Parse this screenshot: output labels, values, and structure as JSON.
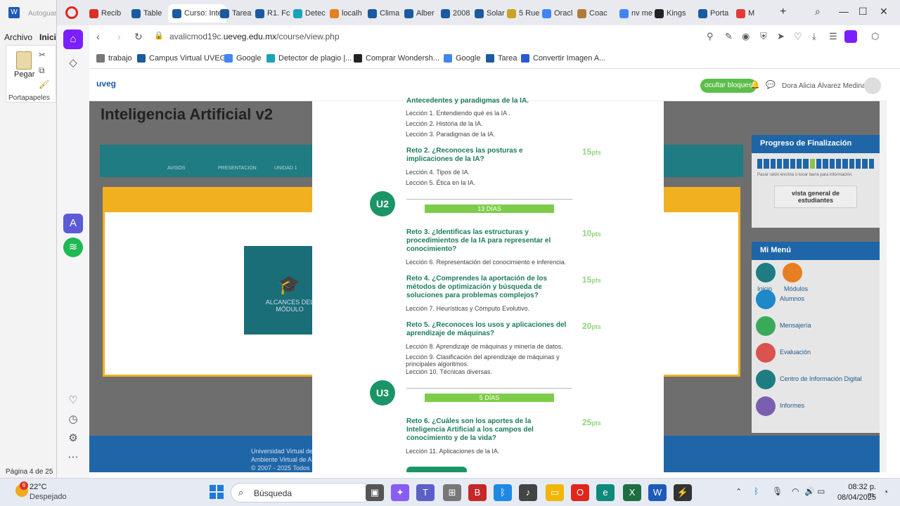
{
  "word": {
    "autosave": "Autoguar",
    "menu_archivo": "Archivo",
    "menu_inicio": "Inicio",
    "paste_label": "Pegar",
    "clipboard_group": "Portapapeles",
    "status": "Página 4 de 25"
  },
  "browser": {
    "tabs": [
      {
        "label": "Recib",
        "color": "#d93025"
      },
      {
        "label": "Table",
        "color": "#1a5aa0"
      },
      {
        "label": "Curso: Inte",
        "color": "#1a5aa0",
        "active": true
      },
      {
        "label": "Tarea",
        "color": "#1a5aa0"
      },
      {
        "label": "R1. Fc",
        "color": "#1a5aa0"
      },
      {
        "label": "Detec",
        "color": "#19a3b8"
      },
      {
        "label": "localh",
        "color": "#e67e22"
      },
      {
        "label": "Clima",
        "color": "#1a5aa0"
      },
      {
        "label": "Alber",
        "color": "#1a5aa0"
      },
      {
        "label": "2008",
        "color": "#1a5aa0"
      },
      {
        "label": "Solar",
        "color": "#1a5aa0"
      },
      {
        "label": "5 Rue",
        "color": "#c9a227"
      },
      {
        "label": "Oracl",
        "color": "#4285f4"
      },
      {
        "label": "Coac",
        "color": "#b07a3a"
      },
      {
        "label": "nv me",
        "color": "#4285f4"
      },
      {
        "label": "Kings",
        "color": "#222"
      },
      {
        "label": "Porta",
        "color": "#1a5aa0"
      },
      {
        "label": "M",
        "color": "#e53935"
      }
    ],
    "url_prefix": "avalicmod19c.",
    "url_domain": "ueveg.edu.mx",
    "url_path": "/course/view.php",
    "bookmarks": [
      {
        "label": "trabajo",
        "color": "#777"
      },
      {
        "label": "Campus Virtual UVEG",
        "color": "#1a5aa0"
      },
      {
        "label": "Google",
        "color": "#4285f4"
      },
      {
        "label": "Detector de plagio |...",
        "color": "#19a3b8"
      },
      {
        "label": "Comprar Wondersh...",
        "color": "#222"
      },
      {
        "label": "Google",
        "color": "#4285f4"
      },
      {
        "label": "Tarea",
        "color": "#1a5aa0"
      },
      {
        "label": "Convertir Imagen A...",
        "color": "#2a5bd7"
      }
    ]
  },
  "site": {
    "logo": "uveg",
    "hide_blocks": "ocultar bloques",
    "user_name": "Dora Alicia Álvarez Medina",
    "course_title": "Inteligencia Artificial v2",
    "teal_items": [
      "AVISOS",
      "PRESENTACIÓN",
      "UNIDAD 1"
    ],
    "module_label": "ALCANCES DEL MÓDULO",
    "progress_title": "Progreso de Finalización",
    "progress_hint": "Pasar ratón encima o tocar barra para información.",
    "students_button": "vista general de estudiantes",
    "menu_title": "Mi Menú",
    "menu_items": [
      "Inicio",
      "Módulos",
      "Alumnos",
      "Mensajería",
      "Evaluación",
      "Centro de Información Digital",
      "Informes"
    ],
    "footer_line1": "Universidad Virtual de",
    "footer_line2": "Ambiente Virtual de A",
    "footer_line3": "© 2007 - 2025 Todos"
  },
  "modal": {
    "partial_heading": "Antecedentes y paradigmas de la IA.",
    "u1_lessons": [
      "Lección 1. Entendiendo qué es la IA .",
      "Lección 2. Historia de la IA.",
      "Lección 3. Paradigmas de la IA."
    ],
    "reto2": {
      "title": "Reto 2. ¿Reconoces las posturas e implicaciones de la IA?",
      "pts": "15",
      "lessons": [
        "Lección 4. Tipos de IA.",
        "Lección 5. Ética en la IA."
      ]
    },
    "u2": {
      "badge": "U2",
      "days": "13 DÍAS"
    },
    "reto3": {
      "title": "Reto 3. ¿Identificas las estructuras y procedimientos de la IA para representar el conocimiento?",
      "pts": "10",
      "lessons": [
        "Lección 6. Representación del conocimiento e inferencia."
      ]
    },
    "reto4": {
      "title": "Reto 4. ¿Comprendes la aportación de los métodos de optimización y búsqueda de soluciones para problemas complejos?",
      "pts": "15",
      "lessons": [
        "Lección 7. Heurísticas y Cómputo Evolutivo."
      ]
    },
    "reto5": {
      "title": "Reto 5. ¿Reconoces los usos y aplicaciones del aprendizaje de máquinas?",
      "pts": "20",
      "lessons": [
        "Lección 8. Aprendizaje de máquinas y minería de datos.",
        "Lección 9. Clasificación del aprendizaje de máquinas y principales algoritmos.",
        "Lección 10. Técnicas diversas."
      ]
    },
    "u3": {
      "badge": "U3",
      "days": "5 DÍAS"
    },
    "reto6": {
      "title": "Reto 6. ¿Cuáles son los aportes de la Inteligencia Artificial a los campos del conocimiento y de la vida?",
      "pts": "25",
      "lessons": [
        "Lección 11. Aplicaciones de la IA."
      ]
    },
    "pts_suffix": "pts"
  },
  "taskbar": {
    "weather_temp": "22°C",
    "weather_desc": "Despejado",
    "weather_badge": "6",
    "search_placeholder": "Búsqueda",
    "time": "08:32 p. m.",
    "date": "08/04/2025"
  }
}
